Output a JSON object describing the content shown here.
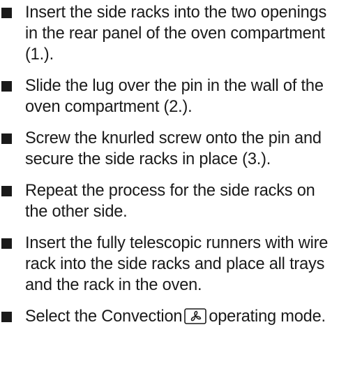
{
  "steps": [
    {
      "text": "Insert the side racks into the two openings in the rear panel of the oven compartment (1.)."
    },
    {
      "text": "Slide the lug over the pin in the wall of the oven compartment (2.)."
    },
    {
      "text": "Screw the knurled screw onto the pin and secure the side racks in place (3.)."
    },
    {
      "text": "Repeat the process for the side racks on the other side."
    },
    {
      "text": "Insert the fully telescopic runners with wire rack into the side racks and place all trays and the rack in the oven."
    },
    {
      "text_before": "Select the Convection",
      "icon": "convection-fan-icon",
      "text_after": "operating mode."
    }
  ]
}
